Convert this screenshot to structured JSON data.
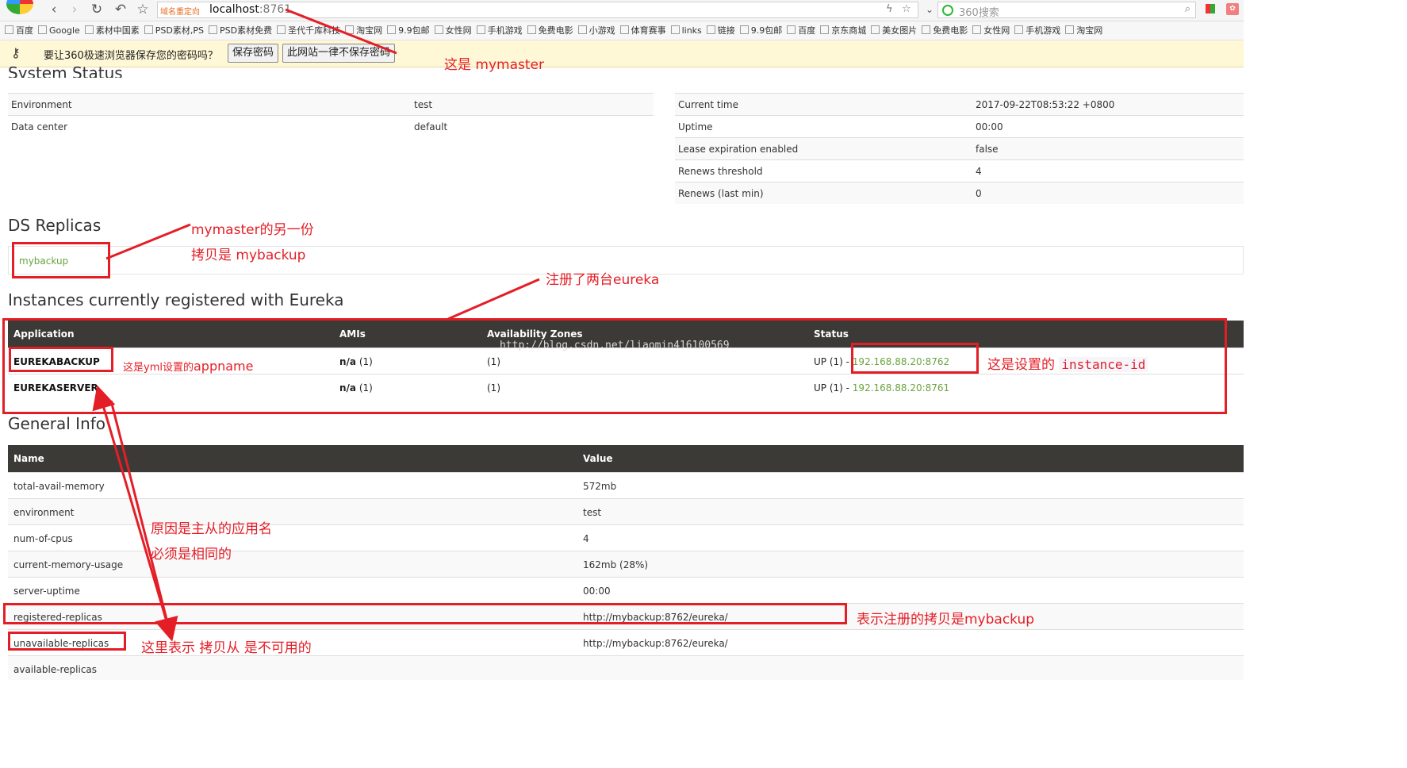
{
  "browser": {
    "redirect_label": "域名重定向",
    "url_host": "localhost",
    "url_port": ":8761",
    "search_placeholder": "360搜索",
    "bookmarks": [
      "百度",
      "Google",
      "素材中国素",
      "PSD素材,PS",
      "PSD素材免费",
      "圣代千库科技",
      "淘宝网",
      "9.9包邮",
      "女性网",
      "手机游戏",
      "免费电影",
      "小游戏",
      "体育赛事",
      "links",
      "链接",
      "9.9包邮",
      "百度",
      "京东商城",
      "美女图片",
      "免费电影",
      "女性网",
      "手机游戏",
      "淘宝网"
    ],
    "password_bar": {
      "message": "要让360极速浏览器保存您的密码吗？",
      "save_button": "保存密码",
      "never_button": "此网站一律不保存密码"
    }
  },
  "system_status": {
    "title": "System Status",
    "left": [
      {
        "label": "Environment",
        "value": "test"
      },
      {
        "label": "Data center",
        "value": "default"
      }
    ],
    "right": [
      {
        "label": "Current time",
        "value": "2017-09-22T08:53:22 +0800"
      },
      {
        "label": "Uptime",
        "value": "00:00"
      },
      {
        "label": "Lease expiration enabled",
        "value": "false"
      },
      {
        "label": "Renews threshold",
        "value": "4"
      },
      {
        "label": "Renews (last min)",
        "value": "0"
      }
    ]
  },
  "ds_replicas": {
    "title": "DS Replicas",
    "items": [
      "mybackup"
    ]
  },
  "instances": {
    "title": "Instances currently registered with Eureka",
    "headers": [
      "Application",
      "AMIs",
      "Availability Zones",
      "Status"
    ],
    "rows": [
      {
        "application": "EUREKABACKUP",
        "amis": "n/a",
        "amis_count": "(1)",
        "zones": "(1)",
        "status": "UP (1) - ",
        "instance": "192.168.88.20:8762"
      },
      {
        "application": "EUREKASERVER",
        "amis": "n/a",
        "amis_count": "(1)",
        "zones": "(1)",
        "status": "UP (1) - ",
        "instance": "192.168.88.20:8761"
      }
    ]
  },
  "watermark": "http://blog.csdn.net/liaomin416100569",
  "general_info": {
    "title": "General Info",
    "headers": [
      "Name",
      "Value"
    ],
    "rows": [
      {
        "name": "total-avail-memory",
        "value": "572mb"
      },
      {
        "name": "environment",
        "value": "test"
      },
      {
        "name": "num-of-cpus",
        "value": "4"
      },
      {
        "name": "current-memory-usage",
        "value": "162mb (28%)"
      },
      {
        "name": "server-uptime",
        "value": "00:00"
      },
      {
        "name": "registered-replicas",
        "value": "http://mybackup:8762/eureka/"
      },
      {
        "name": "unavailable-replicas",
        "value": "http://mybackup:8762/eureka/"
      },
      {
        "name": "available-replicas",
        "value": ""
      }
    ]
  },
  "annotations": {
    "mymaster": "这是 mymaster",
    "backup_line1": "mymaster的另一份",
    "backup_line2": "拷贝是 mybackup",
    "two_eureka": "注册了两台eureka",
    "appname_prefix": "这是yml设置的",
    "appname_code": "appname",
    "instance_prefix": "这是设置的",
    "instance_code": "instance-id",
    "reason_line1": "原因是主从的应用名",
    "reason_line2": "必须是相同的",
    "registered": "表示注册的拷贝是mybackup",
    "unavailable": "这里表示 拷贝从 是不可用的"
  },
  "colors": {
    "annotation_red": "#e41e26",
    "link_green": "#6ba33e",
    "header_dark": "#3b3a37"
  }
}
